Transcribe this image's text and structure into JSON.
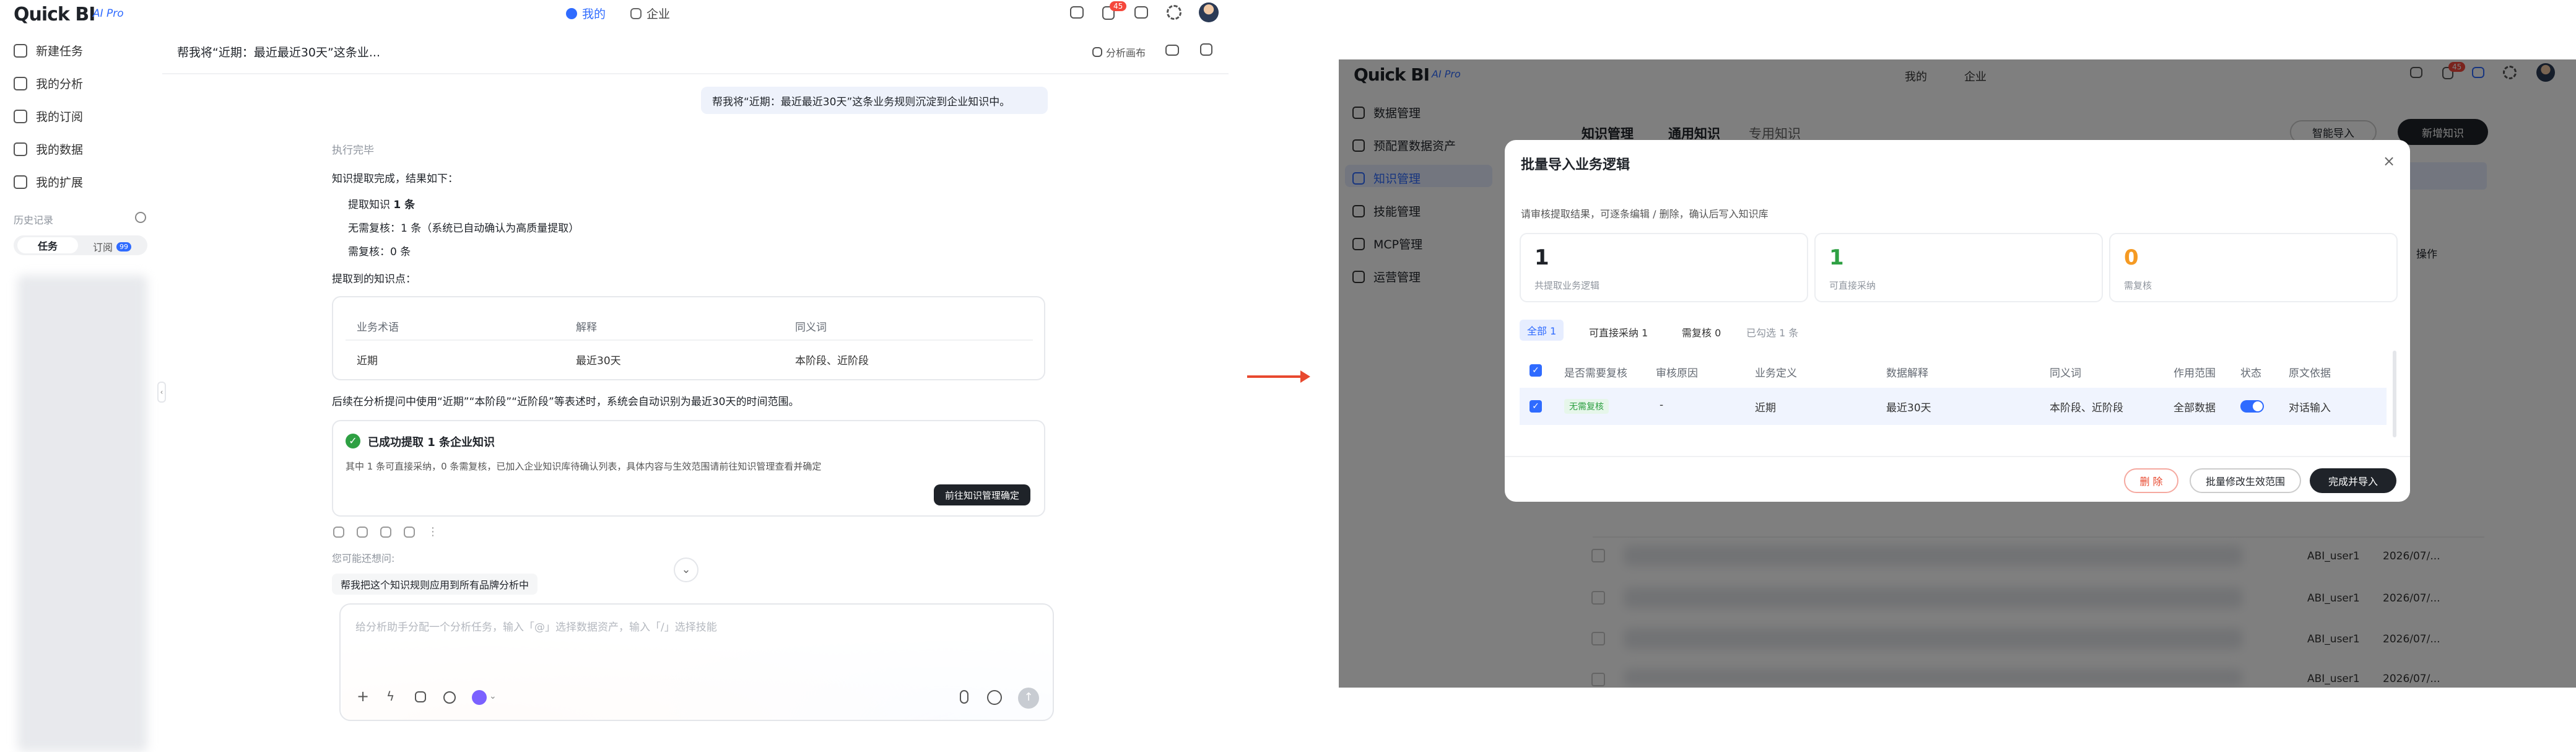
{
  "left": {
    "brand": "Quick BI",
    "brand_tag": "AI Pro",
    "top_tabs": [
      {
        "label": "我的"
      },
      {
        "label": "企业"
      }
    ],
    "notif_badge": "45",
    "sidebar": {
      "items": [
        "新建任务",
        "我的分析",
        "我的订阅",
        "我的数据",
        "我的扩展"
      ],
      "history_title": "历史记录",
      "tabs": [
        {
          "label": "任务"
        },
        {
          "label": "订阅",
          "badge": "99"
        }
      ]
    },
    "chat": {
      "title": "帮我将“近期：最近最近30天”这条业...",
      "header_action": "分析画布",
      "user_msg": "帮我将“近期：最近最近30天”这条业务规则沉淀到企业知识中。",
      "status": "执行完毕",
      "intro": "知识提取完成，结果如下：",
      "bullets": [
        {
          "pre": "提取知识 ",
          "bold": "1 条",
          "post": ""
        },
        {
          "pre": "无需复核：1 条（系统已自动确认为高质量提取）",
          "bold": "",
          "post": ""
        },
        {
          "pre": "需复核：0 条",
          "bold": "",
          "post": ""
        }
      ],
      "points_title": "提取到的知识点：",
      "table": {
        "headers": [
          "业务术语",
          "解释",
          "同义词"
        ],
        "row": [
          "近期",
          "最近30天",
          "本阶段、近阶段"
        ]
      },
      "after_text": "后续在分析提问中使用“近期”“本阶段”“近阶段”等表述时，系统会自动识别为最近30天的时间范围。",
      "success_title": "已成功提取 1 条企业知识",
      "success_desc": "其中 1 条可直接采纳，0 条需复核，已加入企业知识库待确认列表，具体内容与生效范围请前往知识管理查看并确定",
      "success_button": "前往知识管理确定",
      "ask_label": "您可能还想问:",
      "suggestion": "帮我把这个知识规则应用到所有品牌分析中",
      "input_placeholder": "给分析助手分配一个分析任务，输入「@」选择数据资产，输入「/」选择技能"
    }
  },
  "right": {
    "brand": "Quick BI",
    "brand_tag": "AI Pro",
    "top_tabs": [
      {
        "label": "我的"
      },
      {
        "label": "企业"
      }
    ],
    "notif_badge": "45",
    "sidebar": [
      "数据管理",
      "预配置数据资产",
      "知识管理",
      "技能管理",
      "MCP管理",
      "运营管理"
    ],
    "bg_tabs": [
      "知识管理",
      "通用知识",
      "专用知识"
    ],
    "bg_btn_smart": "智能导入",
    "bg_btn_new": "新增知识",
    "bg_col": "操作",
    "bg_rows": [
      {
        "user": "ABI_user1",
        "date": "2026/07/..."
      },
      {
        "user": "ABI_user1",
        "date": "2026/07/..."
      },
      {
        "user": "ABI_user1",
        "date": "2026/07/..."
      },
      {
        "user": "ABI_user1",
        "date": "2026/07/..."
      }
    ],
    "modal": {
      "title": "批量导入业务逻辑",
      "desc": "请审核提取结果，可逐条编辑 / 删除，确认后写入知识库",
      "stats": [
        {
          "value": "1",
          "label": "共提取业务逻辑",
          "color": "#1f2329"
        },
        {
          "value": "1",
          "label": "可直接采纳",
          "color": "#2ea043"
        },
        {
          "value": "0",
          "label": "需复核",
          "color": "#f59a23"
        }
      ],
      "filters": [
        "全部 1",
        "可直接采纳 1",
        "需复核 0",
        "已勾选 1 条"
      ],
      "headers": [
        "是否需要复核",
        "审核原因",
        "业务定义",
        "数据解释",
        "同义词",
        "作用范围",
        "状态",
        "原文依据"
      ],
      "row": {
        "review": "无需复核",
        "reason": "-",
        "definition": "近期",
        "explain": "最近30天",
        "synonyms": "本阶段、近阶段",
        "scope": "全部数据",
        "status_on": true,
        "source": "对话输入"
      },
      "btn_delete": "删 除",
      "btn_batch": "批量修改生效范围",
      "btn_done": "完成并导入"
    }
  },
  "colors": {
    "accent": "#2f6bff",
    "arrow": "#e8492f",
    "success": "#2ea043",
    "warning": "#f59a23",
    "danger": "#e8492f"
  }
}
